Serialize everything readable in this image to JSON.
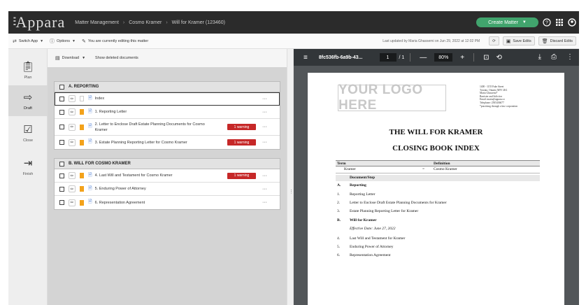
{
  "app": {
    "logo_text": "Appara",
    "breadcrumbs": [
      "Matter Management",
      "Cosmo Kramer",
      "Will for Kramer (123460)"
    ],
    "create_button": "Create Matter",
    "icons": [
      "help-icon",
      "apps-grid-icon",
      "account-icon"
    ]
  },
  "toolbar": {
    "switch_app": "Switch App",
    "options": "Options",
    "editing_notice": "You are currently editing this matter",
    "last_updated": "Last updated by Maria Ghassemi on Jun 29, 2022 at 12:02 PM",
    "save_label": "Save Edits",
    "discard_label": "Discard Edits"
  },
  "rail": {
    "items": [
      {
        "label": "Plan",
        "icon": "clipboard-icon"
      },
      {
        "label": "Draft",
        "icon": "draft-arrow-icon"
      },
      {
        "label": "Close",
        "icon": "checklist-icon"
      },
      {
        "label": "Finish",
        "icon": "exit-icon"
      }
    ],
    "active": "Draft"
  },
  "list": {
    "download": "Download",
    "show_deleted": "Show deleted documents",
    "sections": [
      {
        "title": "A. REPORTING",
        "rows": [
          {
            "title": "Index",
            "bookmark": false,
            "warning": ""
          },
          {
            "title": "1. Reporting Letter",
            "bookmark": true,
            "warning": ""
          },
          {
            "title": "2. Letter to Enclose Draft Estate Planning Documents for Cosmo Kramer",
            "bookmark": true,
            "warning": "1 warning"
          },
          {
            "title": "3. Estate Planning Reporting Letter for Cosmo Kramer",
            "bookmark": true,
            "warning": "1 warning"
          }
        ]
      },
      {
        "title": "B. WILL FOR COSMO KRAMER",
        "rows": [
          {
            "title": "4. Last Will and Testament for Cosmo Kramer",
            "bookmark": true,
            "warning": "1 warning"
          },
          {
            "title": "5. Enduring Power of Attorney",
            "bookmark": true,
            "warning": ""
          },
          {
            "title": "6. Representation Agreement",
            "bookmark": true,
            "warning": ""
          }
        ]
      }
    ],
    "more_glyph": "···"
  },
  "pdf": {
    "filename": "8fc536fb-6a9b-43...",
    "page": "1",
    "pages": "/  1",
    "zoom": "80%",
    "minus": "—",
    "plus": "+",
    "document": {
      "logo": "YOUR LOGO HERE",
      "address_lines": [
        "1400 - 1155 Fake Street",
        "Toronto, Ontario M5V 2K1",
        "Maria Ghassemi*",
        "Barrister and Solicitor",
        "Email: maria@appara.co",
        "Telephone: 2505436677",
        "*practising through a law corporation"
      ],
      "title": "THE WILL FOR KRAMER",
      "subtitle": "CLOSING BOOK INDEX",
      "term_header": "Term",
      "definition_header": "Definition",
      "term": "Kramer",
      "equals": "=",
      "definition": "Cosmo Kramer",
      "doc_step_header": "Document/Step",
      "toc": [
        {
          "num": "A.",
          "label": "Reporting",
          "style": "bold"
        },
        {
          "num": "1.",
          "label": "Reporting Letter",
          "style": ""
        },
        {
          "num": "2.",
          "label": "Letter to Enclose Draft Estate Planning Documents for Kramer",
          "style": ""
        },
        {
          "num": "3.",
          "label": "Estate Planning Reporting Letter for Kramer",
          "style": ""
        },
        {
          "num": "B.",
          "label": "Will for Kramer",
          "style": "bold"
        },
        {
          "num": "",
          "label": "Effective Date: June 27, 2022",
          "style": "ital"
        },
        {
          "num": "4.",
          "label": "Last Will and Testament for Kramer",
          "style": ""
        },
        {
          "num": "5.",
          "label": "Enduring Power of Attorney",
          "style": ""
        },
        {
          "num": "6.",
          "label": "Representation Agreement",
          "style": ""
        }
      ]
    }
  },
  "colors": {
    "accent_green": "#41a46d",
    "warning_red": "#c62828",
    "bookmark_orange": "#f3a21b",
    "topbar": "#2b2b2b"
  }
}
